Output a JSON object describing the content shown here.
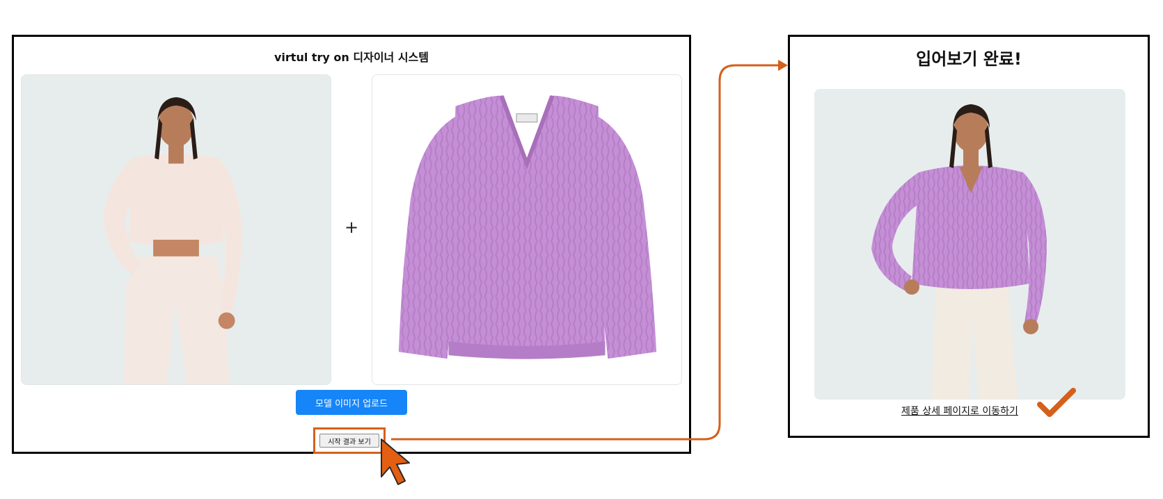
{
  "left_panel": {
    "title": "virtul try on 디자이너 시스템",
    "plus_symbol": "+",
    "upload_button_label": "모델 이미지 업로드",
    "start_button_label": "시작 결과 보기"
  },
  "right_panel": {
    "title": "입어보기 완료!",
    "detail_link_label": "제품 상세 페이지로 이동하기"
  },
  "images": {
    "model_image": "model-photo",
    "garment_image": "purple-cable-knit-sweater",
    "result_image": "model-wearing-purple-sweater"
  },
  "icons": {
    "cursor": "cursor-arrow-icon",
    "check": "checkmark-icon",
    "connector": "flow-arrow"
  },
  "colors": {
    "accent": "#d4601c",
    "primary_button": "#1685f8",
    "photo_background": "#e7eded",
    "sweater": "#c58fd6",
    "panel_border": "#000000"
  }
}
